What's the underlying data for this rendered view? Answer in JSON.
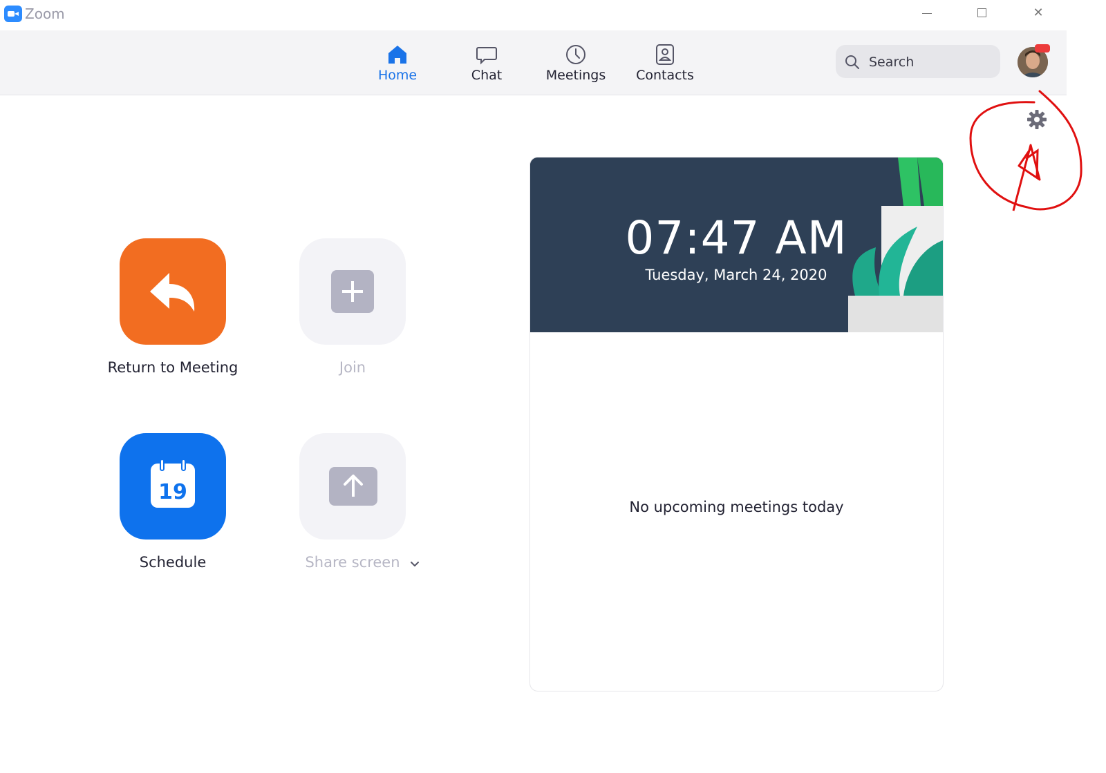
{
  "window": {
    "app_name": "Zoom",
    "controls": [
      "minimize",
      "maximize",
      "close"
    ]
  },
  "toolbar": {
    "tabs": [
      {
        "label": "Home",
        "icon": "home-icon",
        "active": true
      },
      {
        "label": "Chat",
        "icon": "chat-bubble-icon",
        "active": false
      },
      {
        "label": "Meetings",
        "icon": "clock-icon",
        "active": false
      },
      {
        "label": "Contacts",
        "icon": "contact-card-icon",
        "active": false
      }
    ],
    "search": {
      "placeholder": "Search",
      "value": ""
    },
    "profile": {
      "has_notification_badge": true
    }
  },
  "actions": {
    "return_to_meeting": "Return to Meeting",
    "join": "Join",
    "schedule": "Schedule",
    "schedule_calendar_day": "19",
    "share_screen": "Share screen"
  },
  "upcoming": {
    "time": "07:47 AM",
    "date": "Tuesday, March 24, 2020",
    "empty_message": "No upcoming meetings today"
  },
  "colors": {
    "accent_blue": "#0e72ed",
    "active_tab": "#1a73e8",
    "return_orange": "#f26d21",
    "disabled_tile": "#f3f3f7",
    "banner_bg": "#2e4056",
    "annotation_red": "#e01010"
  }
}
